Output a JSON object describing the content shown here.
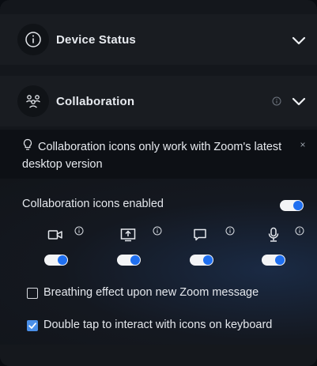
{
  "sections": {
    "device_status": {
      "title": "Device Status",
      "icon": "info-icon",
      "expand_icon": "chevron-down-icon"
    },
    "collaboration": {
      "title": "Collaboration",
      "icon": "people-group-icon",
      "info_icon": "info-icon",
      "expand_icon": "chevron-down-icon"
    }
  },
  "notice": {
    "text": "Collaboration icons only work with Zoom's latest desktop version",
    "icon": "lightbulb-icon",
    "close_label": "×"
  },
  "collaboration_settings": {
    "master_toggle_label": "Collaboration icons enabled",
    "master_toggle_on": true,
    "icons": [
      {
        "name": "video-camera-icon",
        "enabled": true
      },
      {
        "name": "share-screen-icon",
        "enabled": true
      },
      {
        "name": "chat-icon",
        "enabled": true
      },
      {
        "name": "microphone-icon",
        "enabled": true
      }
    ],
    "options": [
      {
        "label": "Breathing effect upon new Zoom message",
        "checked": false
      },
      {
        "label": "Double tap to interact with icons on keyboard",
        "checked": true
      }
    ]
  },
  "colors": {
    "accent": "#1f6ff0",
    "panel": "#14171c",
    "header": "#191c21",
    "text": "#e9ecf1"
  }
}
